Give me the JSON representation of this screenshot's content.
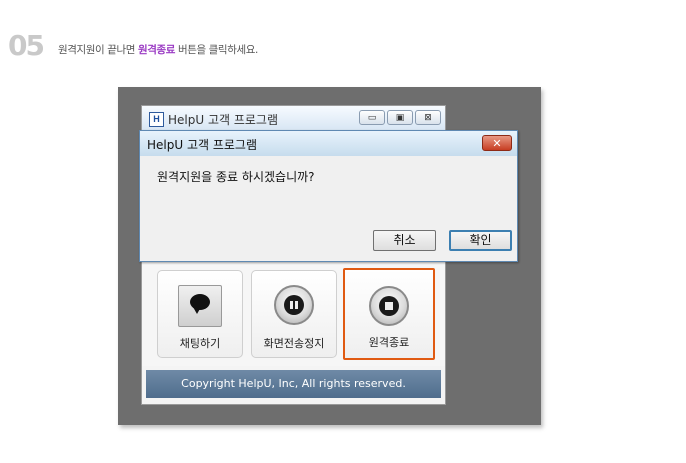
{
  "step": {
    "number": "05"
  },
  "instruction": {
    "before": "원격지원이 끝나면 ",
    "highlight": "원격종료",
    "after": " 버튼을 클릭하세요."
  },
  "app_window": {
    "icon_letter": "H",
    "title": "HelpU 고객 프로그램",
    "window_buttons": [
      "▭",
      "▣",
      "⊠"
    ],
    "features": [
      {
        "label": "채팅하기",
        "icon": "chat-bubble-icon"
      },
      {
        "label": "화면전송정지",
        "icon": "pause-icon"
      },
      {
        "label": "원격종료",
        "icon": "stop-icon"
      }
    ],
    "copyright": "Copyright HelpU, Inc, All rights reserved."
  },
  "dialog": {
    "title": "HelpU 고객 프로그램",
    "close_symbol": "✕",
    "message": "원격지원을 종료 하시겠습니까?",
    "cancel_label": "취소",
    "confirm_label": "확인"
  },
  "colors": {
    "highlight": "#9b3cc4",
    "selected_outline": "#e05a12",
    "backdrop": "#6e6e6e"
  }
}
